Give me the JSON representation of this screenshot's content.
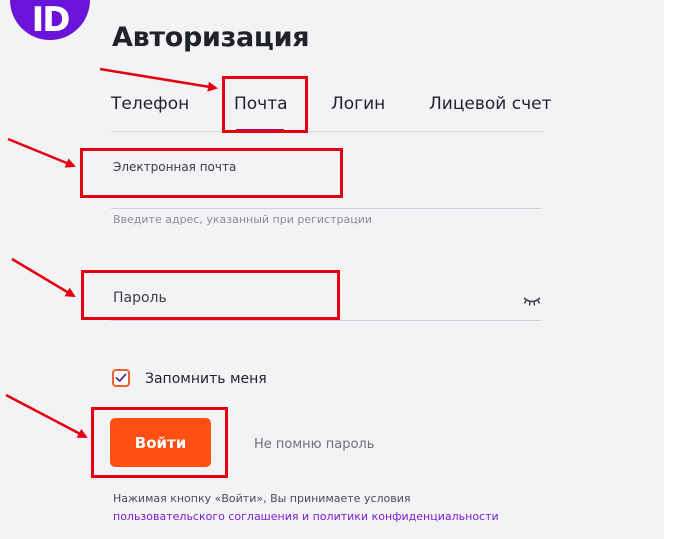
{
  "logo": {
    "text": "ID",
    "color": "#6a14d9"
  },
  "page": {
    "title": "Авторизация"
  },
  "tabs": [
    {
      "label": "Телефон",
      "active": false
    },
    {
      "label": "Почта",
      "active": true
    },
    {
      "label": "Логин",
      "active": false
    },
    {
      "label": "Лицевой счет",
      "active": false
    }
  ],
  "email": {
    "label": "Электронная почта",
    "hint": "Введите адрес, указанный при регистрации"
  },
  "password": {
    "label": "Пароль",
    "toggle_icon": "eye-closed-icon"
  },
  "remember": {
    "label": "Запомнить меня",
    "checked": true
  },
  "login_button": {
    "label": "Войти",
    "color": "#ff4f12"
  },
  "forgot": {
    "label": "Не помню пароль"
  },
  "terms": {
    "text": "Нажимая кнопку «Войти», Вы принимаете условия",
    "link": "пользовательского соглашения и политики конфиденциальности"
  },
  "colors": {
    "accent": "#ff4f12",
    "annotation": "#e3000f",
    "link": "#7a1fd1",
    "tab_underline": "#a1097a"
  }
}
